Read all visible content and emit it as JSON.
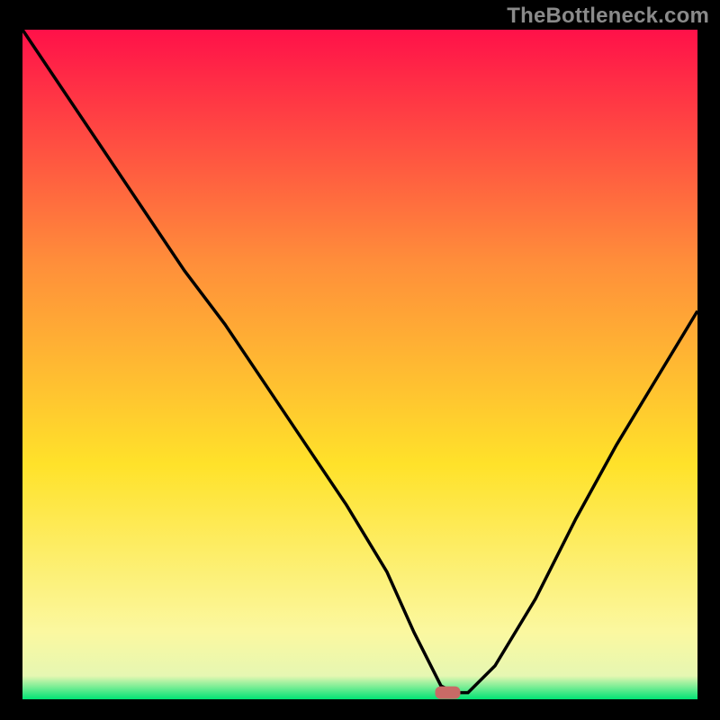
{
  "watermark": "TheBottleneck.com",
  "colors": {
    "background": "#000000",
    "curve": "#000000",
    "marker": "#c96a66",
    "gradient_top": "#ff1149",
    "gradient_mid_upper": "#ff8f3a",
    "gradient_mid": "#ffe22a",
    "gradient_mid_lower": "#fbf8a0",
    "gradient_bottom": "#00e274"
  },
  "chart_data": {
    "type": "line",
    "title": "",
    "xlabel": "",
    "ylabel": "",
    "xlim": [
      0,
      100
    ],
    "ylim": [
      0,
      100
    ],
    "series": [
      {
        "name": "bottleneck-curve",
        "x": [
          0,
          6,
          12,
          18,
          24,
          30,
          36,
          42,
          48,
          54,
          58,
          62,
          64,
          66,
          70,
          76,
          82,
          88,
          94,
          100
        ],
        "y": [
          100,
          91,
          82,
          73,
          64,
          56,
          47,
          38,
          29,
          19,
          10,
          2,
          1,
          1,
          5,
          15,
          27,
          38,
          48,
          58
        ]
      }
    ],
    "marker": {
      "x": 63,
      "y": 1,
      "label": "optimal-point"
    },
    "gradient_stops": [
      {
        "offset": 0.0,
        "color": "#ff1149"
      },
      {
        "offset": 0.35,
        "color": "#ff8f3a"
      },
      {
        "offset": 0.65,
        "color": "#ffe22a"
      },
      {
        "offset": 0.9,
        "color": "#fbf8a0"
      },
      {
        "offset": 0.965,
        "color": "#e6f7b2"
      },
      {
        "offset": 1.0,
        "color": "#00e274"
      }
    ]
  }
}
